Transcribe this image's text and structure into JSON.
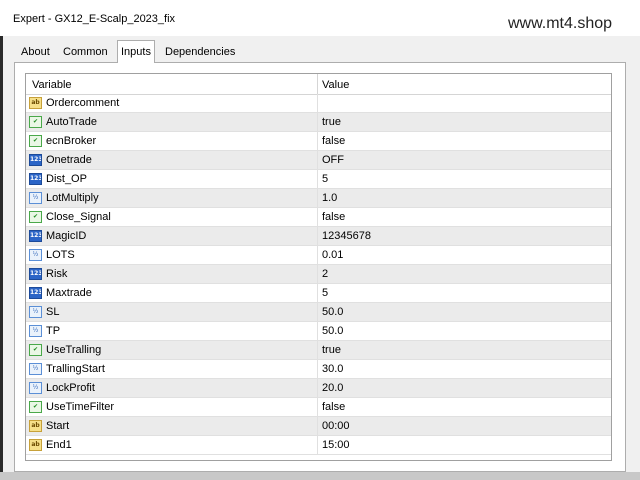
{
  "window": {
    "title": "Expert - GX12_E-Scalp_2023_fix",
    "watermark": "www.mt4.shop"
  },
  "tabs": [
    {
      "label": "About"
    },
    {
      "label": "Common"
    },
    {
      "label": "Inputs",
      "active": true
    },
    {
      "label": "Dependencies"
    }
  ],
  "table": {
    "columns": [
      "Variable",
      "Value"
    ],
    "rows": [
      {
        "type": "ab",
        "name": "Ordercomment",
        "value": ""
      },
      {
        "type": "bool",
        "name": "AutoTrade",
        "value": "true"
      },
      {
        "type": "bool",
        "name": "ecnBroker",
        "value": "false"
      },
      {
        "type": "int",
        "name": "Onetrade",
        "value": "OFF"
      },
      {
        "type": "int",
        "name": "Dist_OP",
        "value": "5"
      },
      {
        "type": "dbl",
        "name": "LotMultiply",
        "value": "1.0"
      },
      {
        "type": "bool",
        "name": "Close_Signal",
        "value": "false"
      },
      {
        "type": "int",
        "name": "MagicID",
        "value": "12345678"
      },
      {
        "type": "dbl",
        "name": "LOTS",
        "value": "0.01"
      },
      {
        "type": "int",
        "name": "Risk",
        "value": "2"
      },
      {
        "type": "int",
        "name": "Maxtrade",
        "value": "5"
      },
      {
        "type": "dbl",
        "name": "SL",
        "value": "50.0"
      },
      {
        "type": "dbl",
        "name": "TP",
        "value": "50.0"
      },
      {
        "type": "bool",
        "name": "UseTralling",
        "value": "true"
      },
      {
        "type": "dbl",
        "name": "TrallingStart",
        "value": "30.0"
      },
      {
        "type": "dbl",
        "name": "LockProfit",
        "value": "20.0"
      },
      {
        "type": "bool",
        "name": "UseTimeFilter",
        "value": "false"
      },
      {
        "type": "ab",
        "name": "Start",
        "value": "00:00"
      },
      {
        "type": "ab",
        "name": "End1",
        "value": "15:00"
      }
    ]
  },
  "icons": {
    "ab": {
      "name": "string-type-icon",
      "glyph": "ab"
    },
    "bool": {
      "name": "boolean-type-icon",
      "glyph": "✔"
    },
    "int": {
      "name": "integer-type-icon",
      "glyph": "123"
    },
    "dbl": {
      "name": "double-type-icon",
      "glyph": "½"
    }
  }
}
